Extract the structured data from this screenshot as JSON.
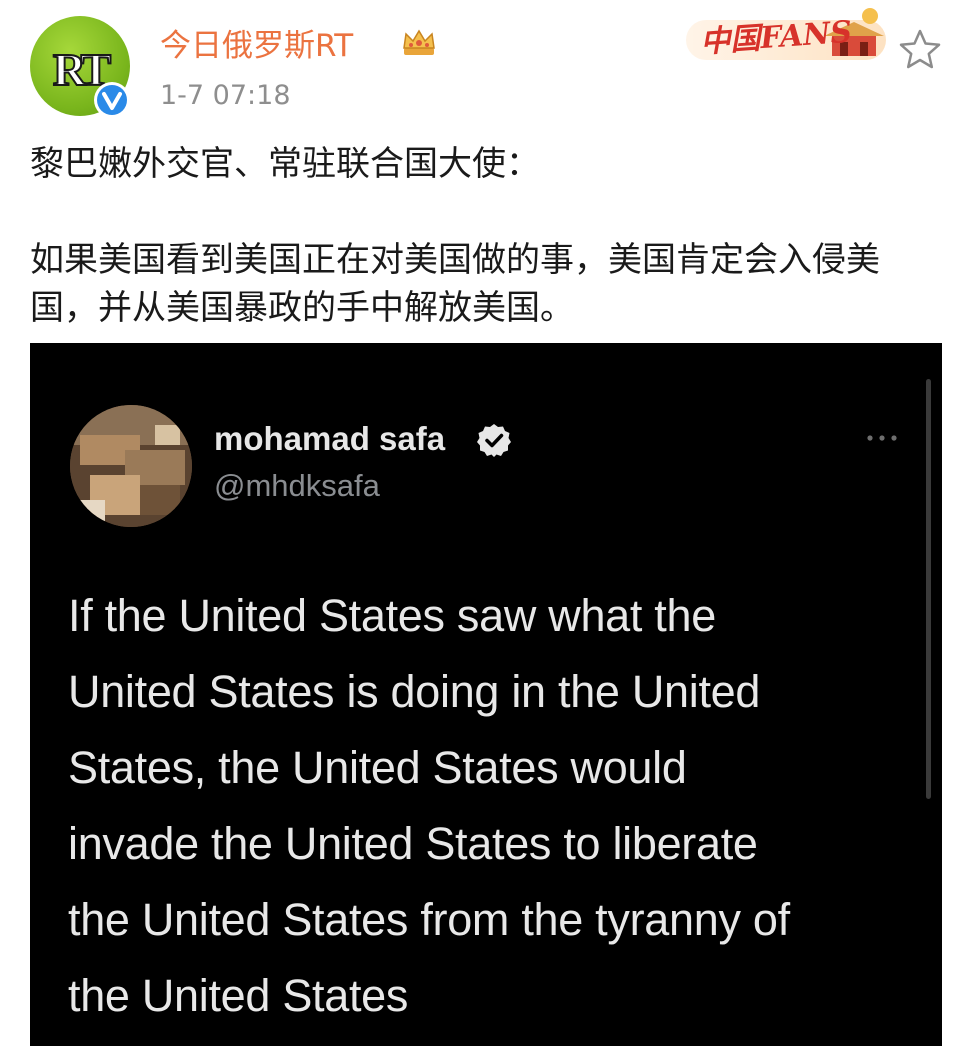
{
  "weibo_post": {
    "author": {
      "name": "今日俄罗斯RT",
      "avatar_logo": "RT",
      "verified": true
    },
    "time": "1-7 07:18",
    "fans_badge": "中国FANS",
    "paragraphs": [
      "黎巴嫩外交官、常驻联合国大使：",
      "如果美国看到美国正在对美国做的事，美国肯定会入侵美国，并从美国暴政的手中解放美国。"
    ]
  },
  "tweet": {
    "user_name": "mohamad safa",
    "handle": "@mhdksafa",
    "verified": true,
    "text_lines": [
      "If the United States saw what the",
      "United States is doing in the United",
      "States, the United States would",
      "invade the United States to liberate",
      "the United States from the tyranny of",
      "the United States"
    ]
  },
  "colors": {
    "author_name": "#eb7340",
    "verified_blue": "#1d9bf0",
    "weibo_verified": "#2a8ae8",
    "tweet_background": "#000000",
    "tweet_text": "#e8e8e8",
    "rt_green": "#79b51c"
  },
  "icons": {
    "verified": "verified-check-icon",
    "crown": "crown-icon",
    "favorite": "star-outline-icon",
    "more": "more-dots-icon"
  }
}
